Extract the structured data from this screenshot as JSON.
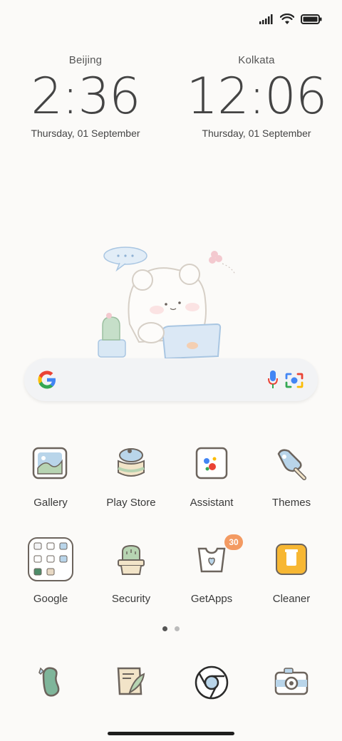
{
  "status_bar": {
    "icons": [
      "signal-icon",
      "wifi-icon",
      "battery-icon"
    ]
  },
  "clocks": [
    {
      "city": "Beijing",
      "time": "2:36",
      "date": "Thursday, 01 September"
    },
    {
      "city": "Kolkata",
      "time": "12:06",
      "date": "Thursday, 01 September"
    }
  ],
  "search": {
    "icons": [
      "google-logo-icon",
      "microphone-icon",
      "lens-camera-icon"
    ]
  },
  "apps_row1": [
    {
      "label": "Gallery",
      "icon": "gallery-icon"
    },
    {
      "label": "Play Store",
      "icon": "play-store-icon"
    },
    {
      "label": "Assistant",
      "icon": "assistant-icon"
    },
    {
      "label": "Themes",
      "icon": "themes-icon"
    }
  ],
  "apps_row2": [
    {
      "label": "Google",
      "icon": "google-folder-icon"
    },
    {
      "label": "Security",
      "icon": "security-icon"
    },
    {
      "label": "GetApps",
      "icon": "getapps-icon",
      "badge": "30"
    },
    {
      "label": "Cleaner",
      "icon": "cleaner-icon"
    }
  ],
  "page_indicator": {
    "pages": 2,
    "active": 1
  },
  "dock": [
    {
      "icon": "phone-icon"
    },
    {
      "icon": "messages-icon"
    },
    {
      "icon": "chrome-icon"
    },
    {
      "icon": "camera-icon"
    }
  ],
  "colors": {
    "background": "#fbfaf8",
    "badge": "#f39a62",
    "accent_green": "#b7d4b2",
    "accent_blue": "#b9d5ea"
  }
}
